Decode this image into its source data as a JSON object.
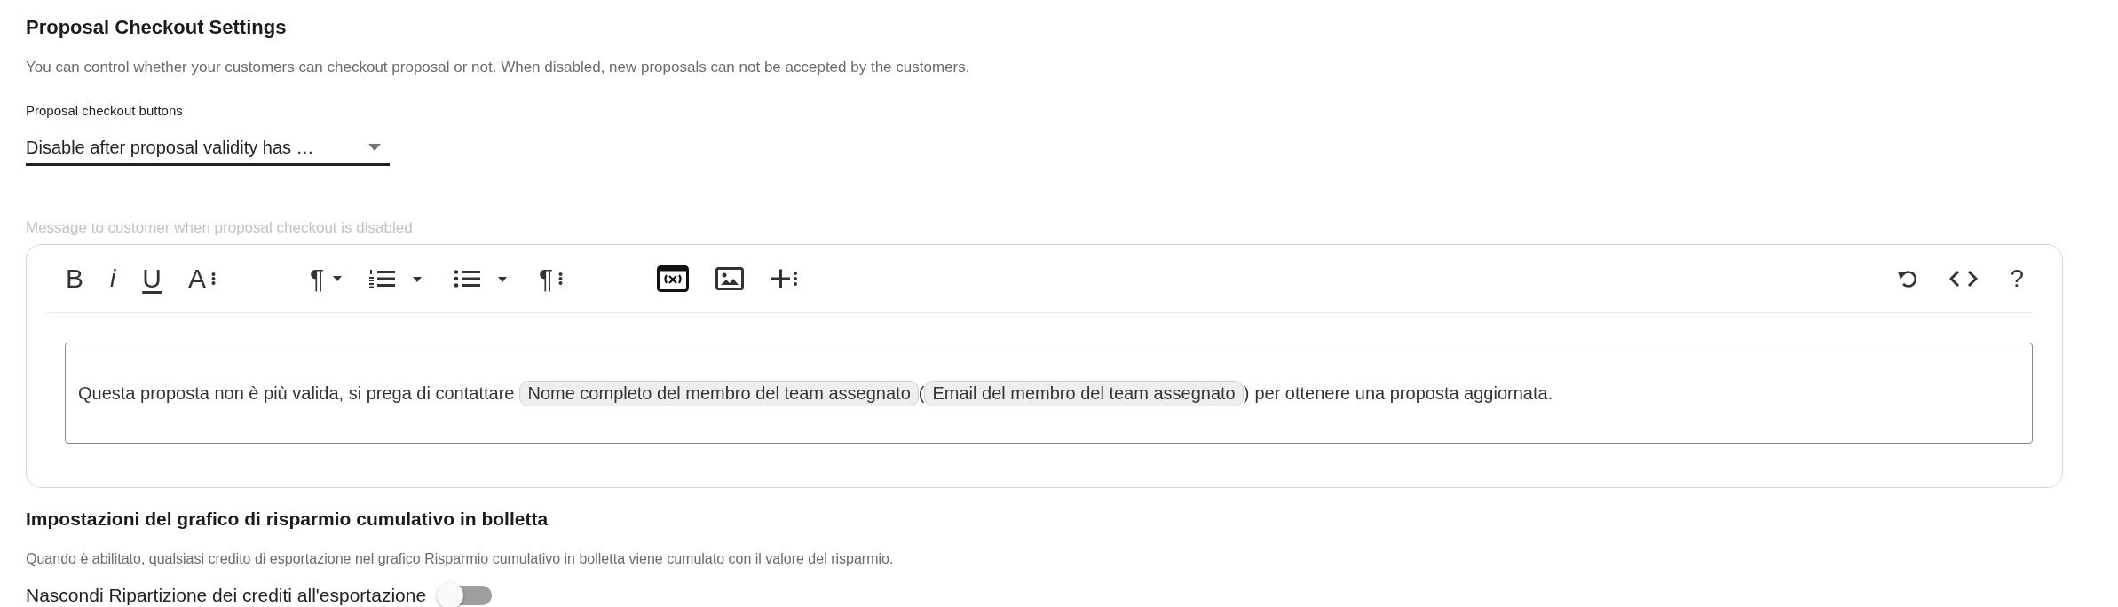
{
  "proposal_checkout": {
    "title": "Proposal Checkout Settings",
    "description": "You can control whether your customers can checkout proposal or not. When disabled, new proposals can not be accepted by the customers.",
    "select": {
      "label": "Proposal checkout buttons",
      "value": "Disable after proposal validity has …"
    },
    "message_label": "Message to customer when proposal checkout is disabled",
    "toolbar_left": [
      {
        "kind": "bold",
        "label": "B"
      },
      {
        "kind": "italic",
        "label": "i"
      },
      {
        "kind": "underline",
        "label": "U"
      },
      {
        "kind": "more",
        "label": "A"
      },
      {
        "kind": "gap"
      },
      {
        "kind": "dropdown",
        "label": "¶"
      },
      {
        "kind": "ordered-list"
      },
      {
        "kind": "bullet-list"
      },
      {
        "kind": "more",
        "label": "¶"
      },
      {
        "kind": "gap"
      },
      {
        "kind": "variable"
      },
      {
        "kind": "image"
      },
      {
        "kind": "insert"
      }
    ],
    "toolbar_right": [
      {
        "kind": "undo"
      },
      {
        "kind": "code"
      },
      {
        "kind": "text",
        "label": "?"
      }
    ],
    "content": [
      {
        "kind": "text",
        "text": "Questa proposta non è più valida, si prega di contattare"
      },
      {
        "kind": "tag",
        "text": "Nome completo del membro del team assegnato"
      },
      {
        "kind": "text",
        "text": "("
      },
      {
        "kind": "tag",
        "text": "Email del membro del team assegnato"
      },
      {
        "kind": "text",
        "text": ")"
      },
      {
        "kind": "text",
        "text": "per ottenere una proposta aggiornata."
      }
    ]
  },
  "bill_savings_chart": {
    "title": "Impostazioni del grafico di risparmio cumulativo in bolletta",
    "description": "Quando è abilitato, qualsiasi credito di esportazione nel grafico Risparmio cumulativo in bolletta viene cumulato con il valore del risparmio.",
    "toggle": {
      "label": "Nascondi Ripartizione dei crediti all'esportazione",
      "on": false
    }
  }
}
